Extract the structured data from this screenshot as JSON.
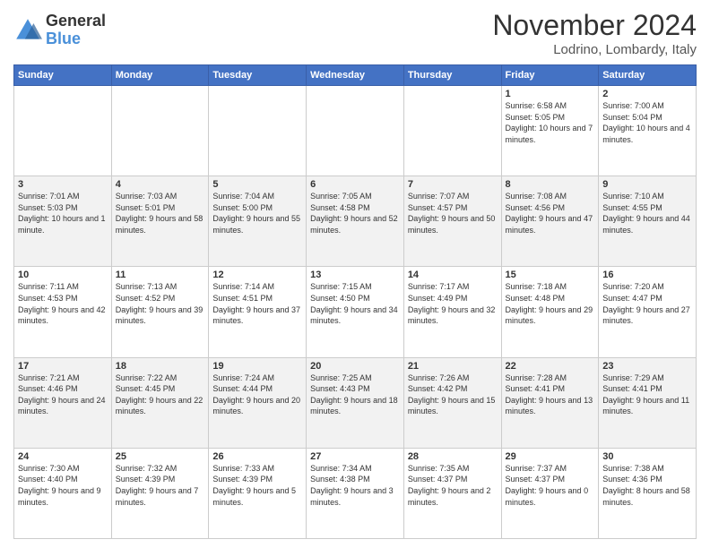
{
  "header": {
    "logo_line1": "General",
    "logo_line2": "Blue",
    "month": "November 2024",
    "location": "Lodrino, Lombardy, Italy"
  },
  "weekdays": [
    "Sunday",
    "Monday",
    "Tuesday",
    "Wednesday",
    "Thursday",
    "Friday",
    "Saturday"
  ],
  "weeks": [
    [
      {
        "day": "",
        "info": ""
      },
      {
        "day": "",
        "info": ""
      },
      {
        "day": "",
        "info": ""
      },
      {
        "day": "",
        "info": ""
      },
      {
        "day": "",
        "info": ""
      },
      {
        "day": "1",
        "info": "Sunrise: 6:58 AM\nSunset: 5:05 PM\nDaylight: 10 hours and 7 minutes."
      },
      {
        "day": "2",
        "info": "Sunrise: 7:00 AM\nSunset: 5:04 PM\nDaylight: 10 hours and 4 minutes."
      }
    ],
    [
      {
        "day": "3",
        "info": "Sunrise: 7:01 AM\nSunset: 5:03 PM\nDaylight: 10 hours and 1 minute."
      },
      {
        "day": "4",
        "info": "Sunrise: 7:03 AM\nSunset: 5:01 PM\nDaylight: 9 hours and 58 minutes."
      },
      {
        "day": "5",
        "info": "Sunrise: 7:04 AM\nSunset: 5:00 PM\nDaylight: 9 hours and 55 minutes."
      },
      {
        "day": "6",
        "info": "Sunrise: 7:05 AM\nSunset: 4:58 PM\nDaylight: 9 hours and 52 minutes."
      },
      {
        "day": "7",
        "info": "Sunrise: 7:07 AM\nSunset: 4:57 PM\nDaylight: 9 hours and 50 minutes."
      },
      {
        "day": "8",
        "info": "Sunrise: 7:08 AM\nSunset: 4:56 PM\nDaylight: 9 hours and 47 minutes."
      },
      {
        "day": "9",
        "info": "Sunrise: 7:10 AM\nSunset: 4:55 PM\nDaylight: 9 hours and 44 minutes."
      }
    ],
    [
      {
        "day": "10",
        "info": "Sunrise: 7:11 AM\nSunset: 4:53 PM\nDaylight: 9 hours and 42 minutes."
      },
      {
        "day": "11",
        "info": "Sunrise: 7:13 AM\nSunset: 4:52 PM\nDaylight: 9 hours and 39 minutes."
      },
      {
        "day": "12",
        "info": "Sunrise: 7:14 AM\nSunset: 4:51 PM\nDaylight: 9 hours and 37 minutes."
      },
      {
        "day": "13",
        "info": "Sunrise: 7:15 AM\nSunset: 4:50 PM\nDaylight: 9 hours and 34 minutes."
      },
      {
        "day": "14",
        "info": "Sunrise: 7:17 AM\nSunset: 4:49 PM\nDaylight: 9 hours and 32 minutes."
      },
      {
        "day": "15",
        "info": "Sunrise: 7:18 AM\nSunset: 4:48 PM\nDaylight: 9 hours and 29 minutes."
      },
      {
        "day": "16",
        "info": "Sunrise: 7:20 AM\nSunset: 4:47 PM\nDaylight: 9 hours and 27 minutes."
      }
    ],
    [
      {
        "day": "17",
        "info": "Sunrise: 7:21 AM\nSunset: 4:46 PM\nDaylight: 9 hours and 24 minutes."
      },
      {
        "day": "18",
        "info": "Sunrise: 7:22 AM\nSunset: 4:45 PM\nDaylight: 9 hours and 22 minutes."
      },
      {
        "day": "19",
        "info": "Sunrise: 7:24 AM\nSunset: 4:44 PM\nDaylight: 9 hours and 20 minutes."
      },
      {
        "day": "20",
        "info": "Sunrise: 7:25 AM\nSunset: 4:43 PM\nDaylight: 9 hours and 18 minutes."
      },
      {
        "day": "21",
        "info": "Sunrise: 7:26 AM\nSunset: 4:42 PM\nDaylight: 9 hours and 15 minutes."
      },
      {
        "day": "22",
        "info": "Sunrise: 7:28 AM\nSunset: 4:41 PM\nDaylight: 9 hours and 13 minutes."
      },
      {
        "day": "23",
        "info": "Sunrise: 7:29 AM\nSunset: 4:41 PM\nDaylight: 9 hours and 11 minutes."
      }
    ],
    [
      {
        "day": "24",
        "info": "Sunrise: 7:30 AM\nSunset: 4:40 PM\nDaylight: 9 hours and 9 minutes."
      },
      {
        "day": "25",
        "info": "Sunrise: 7:32 AM\nSunset: 4:39 PM\nDaylight: 9 hours and 7 minutes."
      },
      {
        "day": "26",
        "info": "Sunrise: 7:33 AM\nSunset: 4:39 PM\nDaylight: 9 hours and 5 minutes."
      },
      {
        "day": "27",
        "info": "Sunrise: 7:34 AM\nSunset: 4:38 PM\nDaylight: 9 hours and 3 minutes."
      },
      {
        "day": "28",
        "info": "Sunrise: 7:35 AM\nSunset: 4:37 PM\nDaylight: 9 hours and 2 minutes."
      },
      {
        "day": "29",
        "info": "Sunrise: 7:37 AM\nSunset: 4:37 PM\nDaylight: 9 hours and 0 minutes."
      },
      {
        "day": "30",
        "info": "Sunrise: 7:38 AM\nSunset: 4:36 PM\nDaylight: 8 hours and 58 minutes."
      }
    ]
  ]
}
